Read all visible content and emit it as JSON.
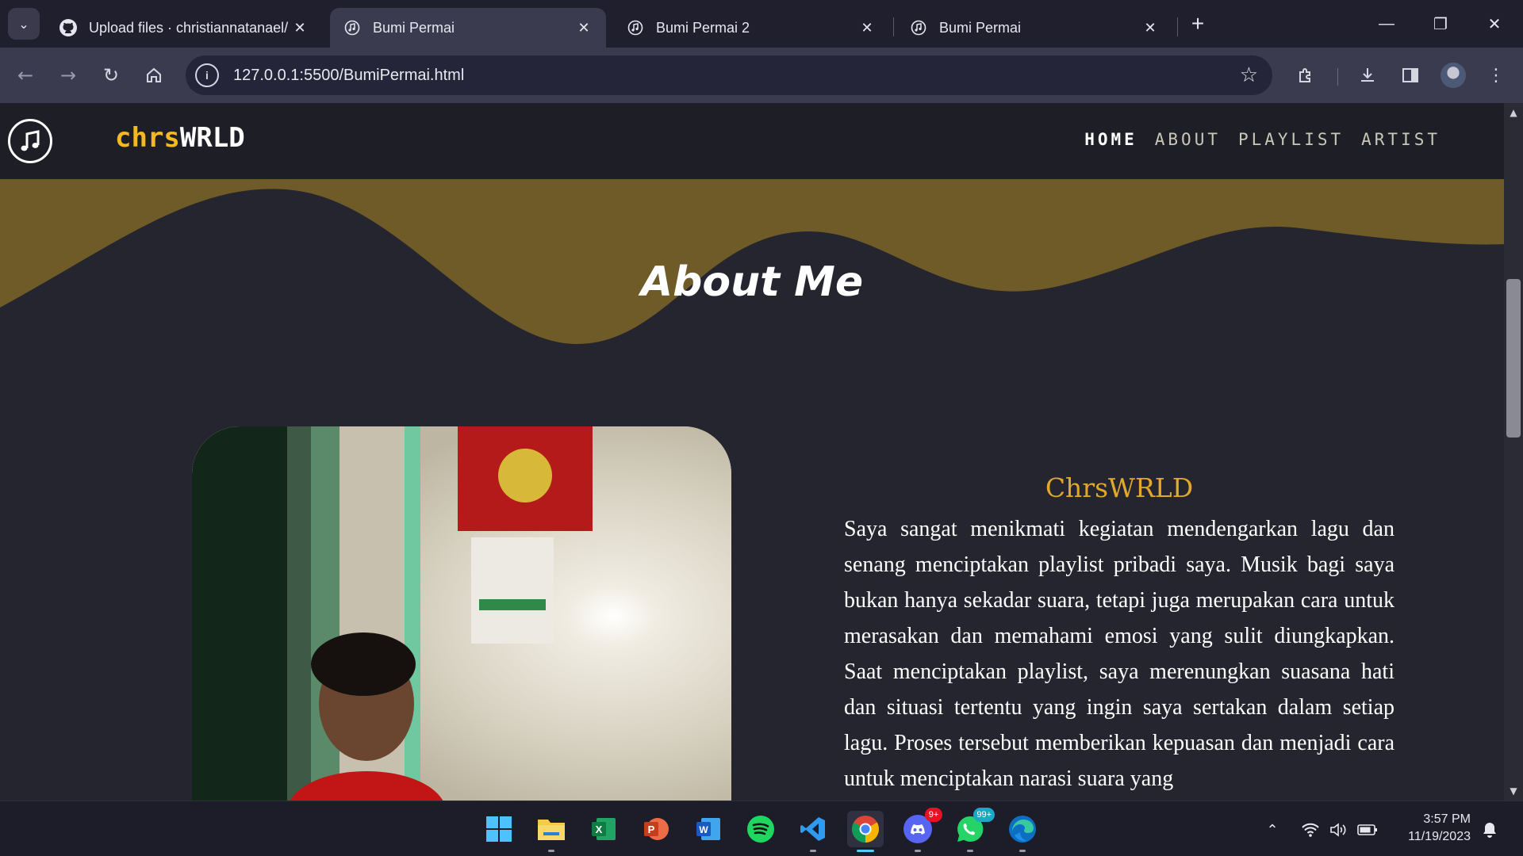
{
  "browser": {
    "tabs": [
      {
        "title": "Upload files · christiannatanael/",
        "icon": "github-icon",
        "active": false
      },
      {
        "title": "Bumi Permai",
        "icon": "music-note-icon",
        "active": true
      },
      {
        "title": "Bumi Permai 2",
        "icon": "music-note-icon",
        "active": false
      },
      {
        "title": "Bumi Permai",
        "icon": "music-note-icon",
        "active": false
      }
    ],
    "url": "127.0.0.1:5500/BumiPermai.html"
  },
  "site": {
    "brand_part1": "chrs",
    "brand_part2": "WRLD",
    "menu": [
      "HOME",
      "ABOUT",
      "PLAYLIST",
      "ARTIST"
    ],
    "active_menu": "HOME",
    "accent_color": "#f5b820",
    "wave_color": "#6f5b28"
  },
  "hero": {
    "title": "About Me"
  },
  "about": {
    "name": "ChrsWRLD",
    "paragraph": "Saya sangat menikmati kegiatan mendengarkan lagu dan senang menciptakan playlist pribadi saya. Musik bagi saya bukan hanya sekadar suara, tetapi juga merupakan cara untuk merasakan dan memahami emosi yang sulit diungkapkan. Saat menciptakan playlist, saya merenungkan suasana hati dan situasi tertentu yang ingin saya sertakan dalam setiap lagu. Proses tersebut memberikan kepuasan dan menjadi cara untuk menciptakan narasi suara yang"
  },
  "taskbar": {
    "apps": [
      "windows-start-icon",
      "file-explorer-icon",
      "excel-icon",
      "powerpoint-icon",
      "word-icon",
      "spotify-icon",
      "vscode-icon",
      "chrome-icon",
      "discord-icon",
      "whatsapp-icon",
      "edge-icon"
    ],
    "discord_badge": "9+",
    "whatsapp_badge": "99+",
    "time": "3:57 PM",
    "date": "11/19/2023"
  }
}
